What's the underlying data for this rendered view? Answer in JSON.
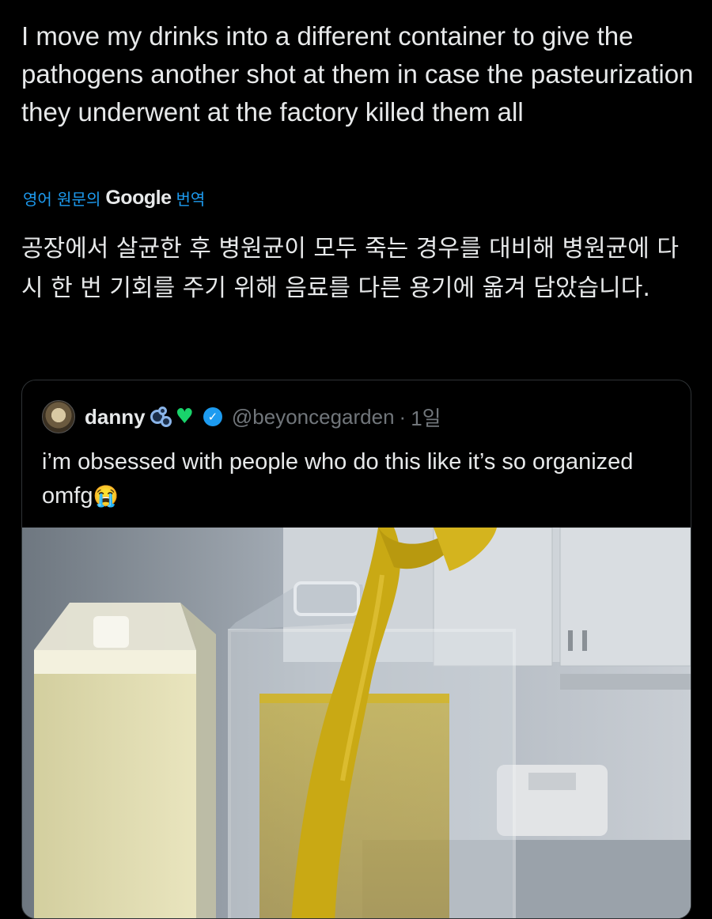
{
  "post": {
    "text": "I move my drinks into a different container to give the pathogens another shot at them in case the pasteurization they underwent at the factory killed them all"
  },
  "translation": {
    "prefix": "영어 원문의",
    "provider": "Google",
    "suffix": "번역",
    "text": "공장에서 살균한 후 병원균이 모두 죽는 경우를 대비해 병원균에 다시 한 번 기회를 주기 위해 음료를 다른 용기에 옮겨 담았습니다."
  },
  "quoted": {
    "display_name": "danny",
    "handle": "@beyoncegarden",
    "separator": "·",
    "time": "1일",
    "text": "i’m obsessed with people who do this like it’s so organized omfg",
    "crying_emoji": "😭"
  },
  "colors": {
    "background": "#000000",
    "text": "#e7e9ea",
    "link": "#1d9bf0",
    "muted": "#71767b",
    "border": "#2f3336",
    "juice": "#b89a12"
  },
  "icons": [
    "avatar",
    "bubbles-emoji",
    "green-heart-emoji",
    "verified-badge-icon",
    "crying-emoji"
  ]
}
